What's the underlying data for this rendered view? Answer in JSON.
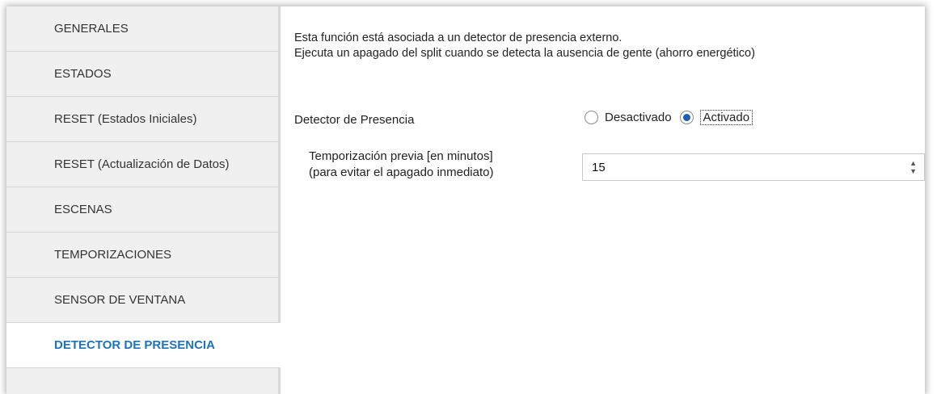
{
  "sidebar": {
    "items": [
      {
        "label": "GENERALES"
      },
      {
        "label": "ESTADOS"
      },
      {
        "label": "RESET (Estados Iniciales)"
      },
      {
        "label": "RESET (Actualización de Datos)"
      },
      {
        "label": "ESCENAS"
      },
      {
        "label": "TEMPORIZACIONES"
      },
      {
        "label": "SENSOR DE VENTANA"
      },
      {
        "label": "DETECTOR DE PRESENCIA",
        "active": true
      }
    ]
  },
  "main": {
    "intro_line1": "Esta función está asociada a un detector de presencia externo.",
    "intro_line2": "Ejecuta un apagado del split cuando se detecta la ausencia de gente (ahorro energético)",
    "presence": {
      "label": "Detector de Presencia",
      "option_off": "Desactivado",
      "option_on": "Activado",
      "selected": "Activado"
    },
    "delay": {
      "label_line1": "Temporización previa [en minutos]",
      "label_line2": "(para evitar el apagado inmediato)",
      "value": "15"
    }
  },
  "colors": {
    "accent": "#1e73be",
    "sidebar_bg": "#f0f0f0"
  }
}
